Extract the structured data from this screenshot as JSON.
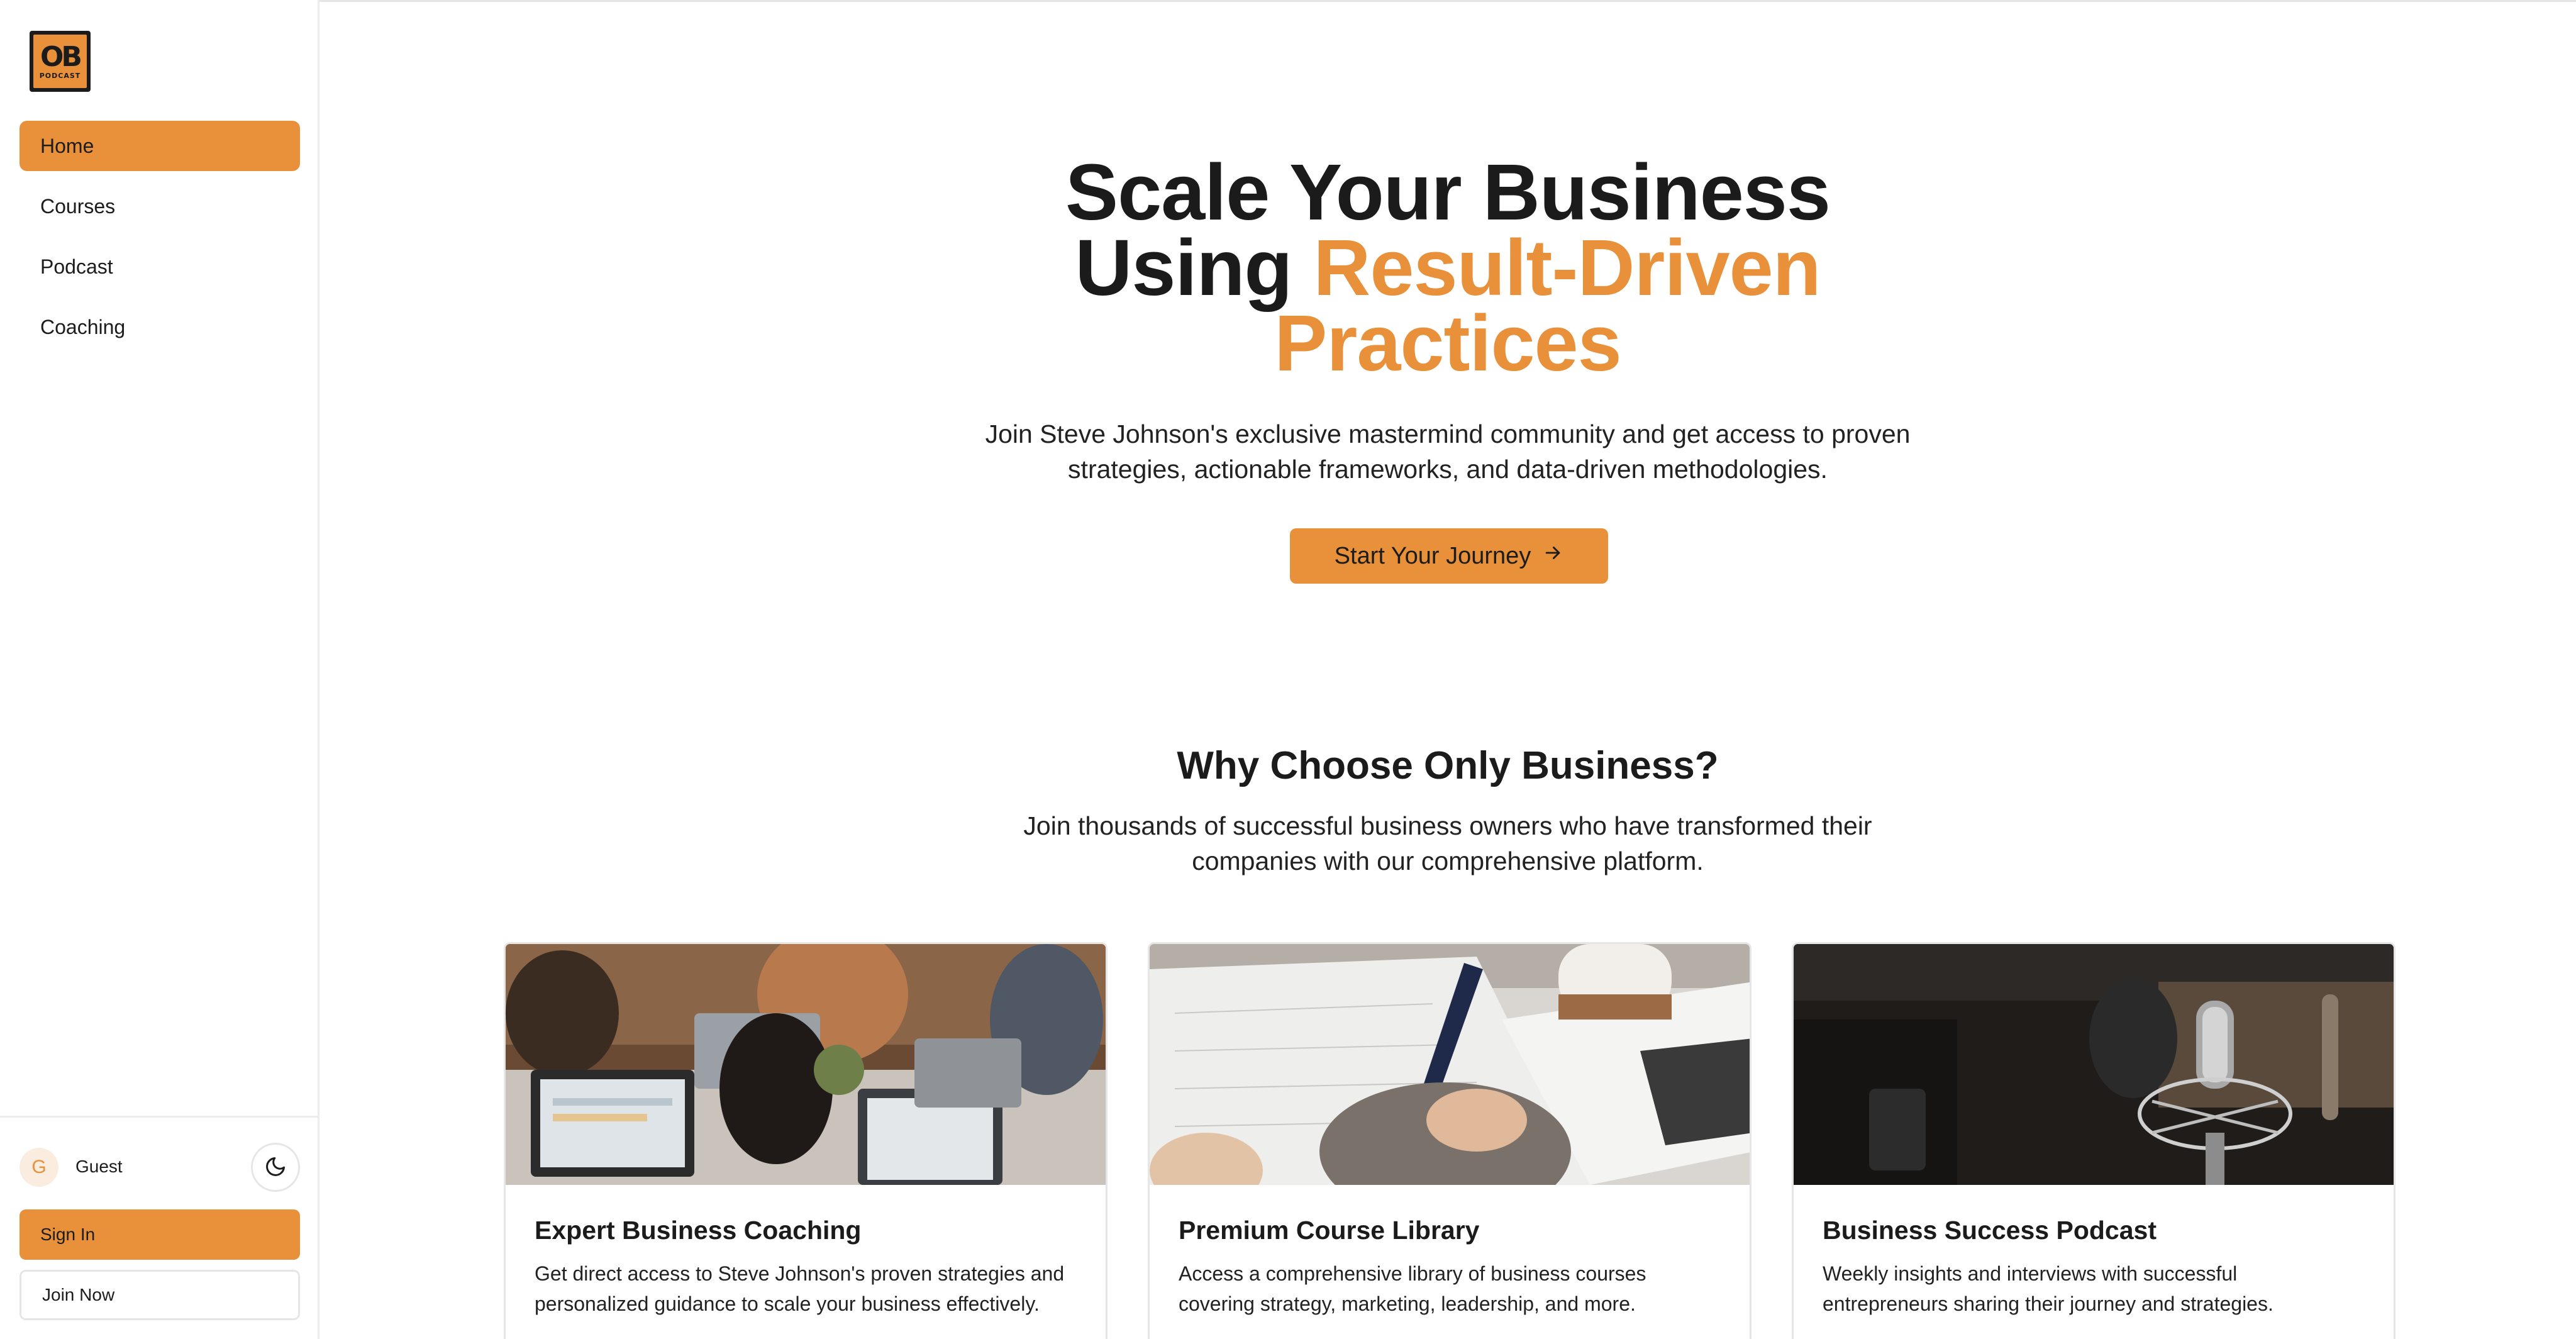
{
  "brand": {
    "logo_mark": "OB",
    "logo_sub": "PODCAST",
    "colors": {
      "accent": "#e8913a",
      "text": "#1b1b1b",
      "border": "#e6e6e6"
    }
  },
  "sidebar": {
    "items": [
      {
        "label": "Home",
        "active": true
      },
      {
        "label": "Courses",
        "active": false
      },
      {
        "label": "Podcast",
        "active": false
      },
      {
        "label": "Coaching",
        "active": false
      }
    ],
    "user": {
      "initial": "G",
      "name": "Guest"
    },
    "theme_toggle_icon": "moon-icon",
    "sign_in_label": "Sign In",
    "join_label": "Join Now"
  },
  "hero": {
    "title_line1": "Scale Your Business",
    "title_line2_prefix": "Using ",
    "title_accent_a": "Result-Driven",
    "title_accent_b": "Practices",
    "subtitle": "Join Steve Johnson's exclusive mastermind community and get access to proven strategies, actionable frameworks, and data-driven methodologies.",
    "cta_label": "Start Your Journey",
    "cta_icon": "arrow-right-icon"
  },
  "why": {
    "title": "Why Choose Only Business?",
    "subtitle": "Join thousands of successful business owners who have transformed their companies with our comprehensive platform."
  },
  "features": [
    {
      "title": "Expert Business Coaching",
      "description": "Get direct access to Steve Johnson's proven strategies and personalized guidance to scale your business effectively."
    },
    {
      "title": "Premium Course Library",
      "description": "Access a comprehensive library of business courses covering strategy, marketing, leadership, and more."
    },
    {
      "title": "Business Success Podcast",
      "description": "Weekly insights and interviews with successful entrepreneurs sharing their journey and strategies."
    }
  ]
}
